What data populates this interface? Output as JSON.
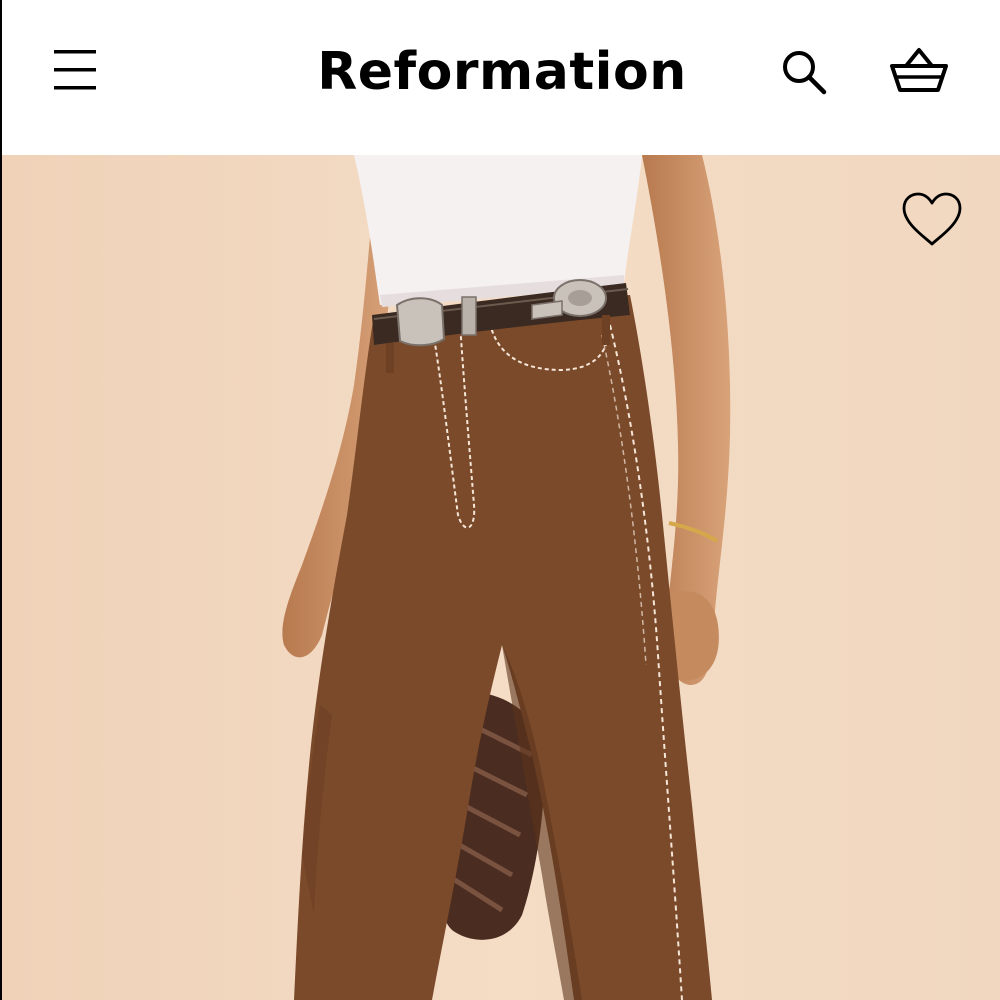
{
  "header": {
    "brand": "Reformation",
    "menu_icon": "hamburger-menu-icon",
    "search_icon": "search-icon",
    "bag_icon": "shopping-basket-icon"
  },
  "product": {
    "image": "product-photo",
    "favorite_icon": "heart-outline-icon"
  },
  "colors": {
    "background": "#f2d6bd",
    "pants": "#7b4a2a",
    "top": "#f6f1f1",
    "skin": "#c98e63"
  }
}
